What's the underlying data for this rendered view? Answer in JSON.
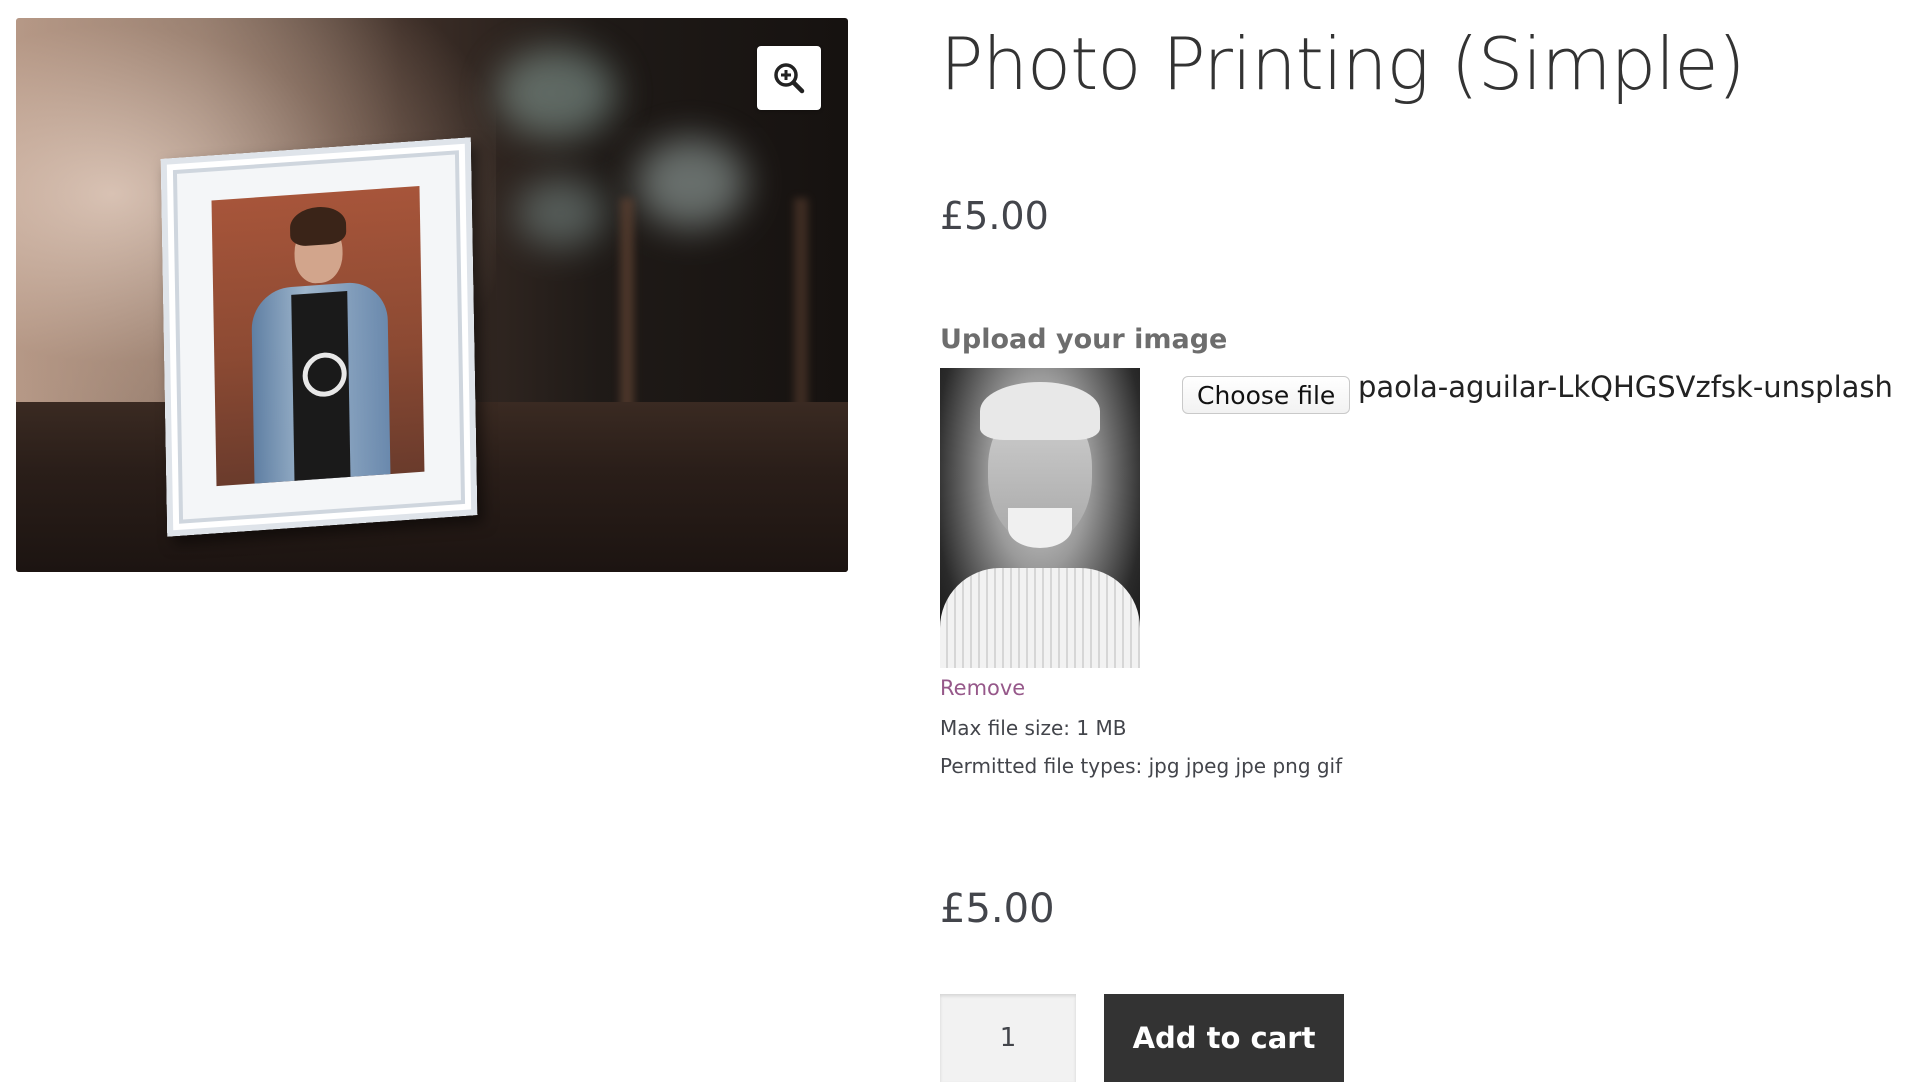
{
  "product": {
    "title": "Photo Printing (Simple)",
    "price": "£5.00"
  },
  "gallery": {
    "zoom_icon": "zoom-in-icon"
  },
  "upload": {
    "label": "Upload your image",
    "choose_file_label": "Choose file",
    "file_name": "paola-aguilar-LkQHGSVzfsk-unsplash",
    "remove_label": "Remove",
    "max_size": "Max file size: 1 MB",
    "permitted_types": "Permitted file types: jpg jpeg jpe png gif"
  },
  "cart": {
    "total_price": "£5.00",
    "quantity": "1",
    "add_to_cart_label": "Add to cart"
  },
  "colors": {
    "accent_link": "#96588a",
    "button_bg": "#333333"
  }
}
